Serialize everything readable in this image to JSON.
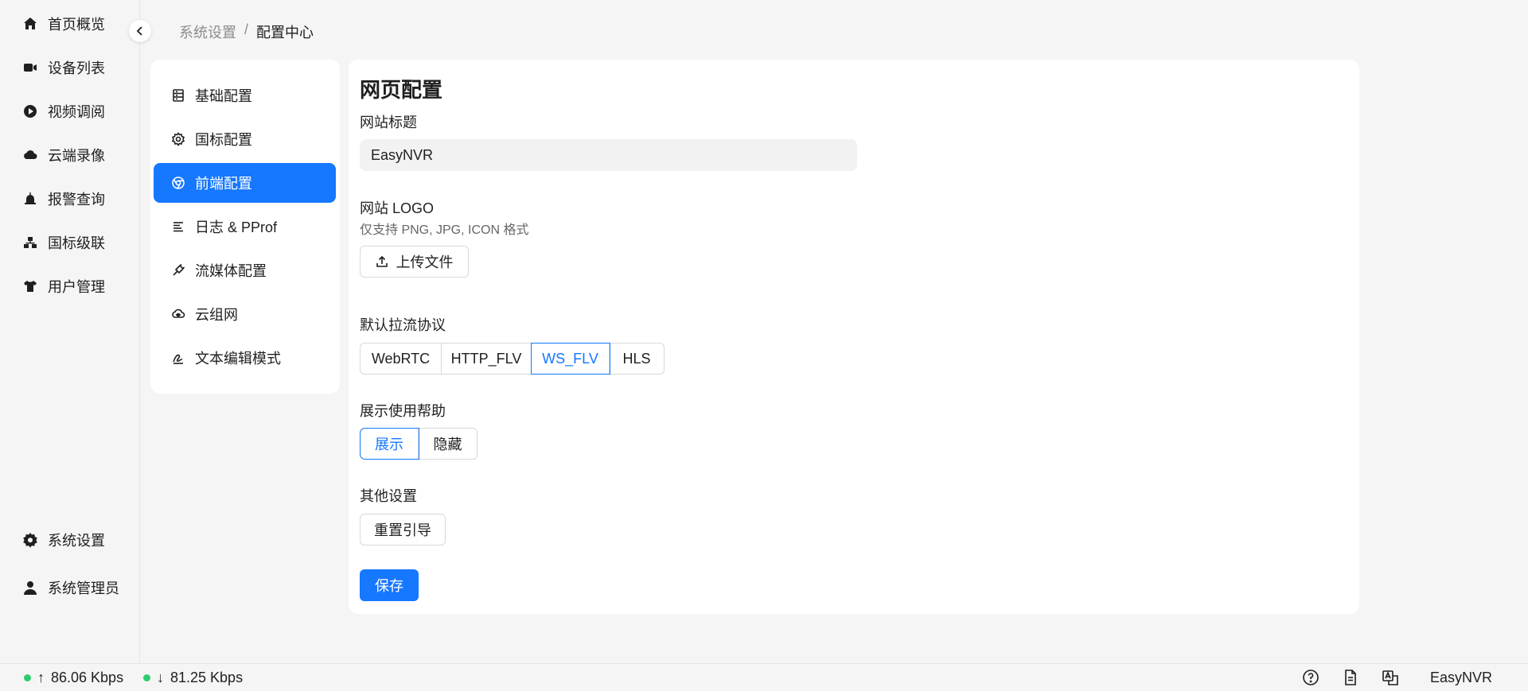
{
  "nav": {
    "items": [
      {
        "label": "首页概览",
        "icon": "home-icon"
      },
      {
        "label": "设备列表",
        "icon": "camera-icon"
      },
      {
        "label": "视频调阅",
        "icon": "play-circle-icon"
      },
      {
        "label": "云端录像",
        "icon": "cloud-icon"
      },
      {
        "label": "报警查询",
        "icon": "alarm-icon"
      },
      {
        "label": "国标级联",
        "icon": "cascade-icon"
      },
      {
        "label": "用户管理",
        "icon": "shirt-icon"
      }
    ],
    "bottom": [
      {
        "label": "系统设置",
        "icon": "gear-icon"
      },
      {
        "label": "系统管理员",
        "icon": "user-icon"
      }
    ]
  },
  "breadcrumb": {
    "parent": "系统设置",
    "separator": "/",
    "current": "配置中心"
  },
  "submenu": {
    "items": [
      {
        "label": "基础配置",
        "icon": "server-icon"
      },
      {
        "label": "国标配置",
        "icon": "gear-icon"
      },
      {
        "label": "前端配置",
        "icon": "chrome-icon",
        "active": true
      },
      {
        "label": "日志 & PProf",
        "icon": "align-left-icon"
      },
      {
        "label": "流媒体配置",
        "icon": "plug-icon"
      },
      {
        "label": "云组网",
        "icon": "cloud-network-icon"
      },
      {
        "label": "文本编辑模式",
        "icon": "signature-icon"
      }
    ]
  },
  "form": {
    "title": "网页配置",
    "site_title_label": "网站标题",
    "site_title_value": "EasyNVR",
    "logo_label": "网站 LOGO",
    "logo_hint": "仅支持 PNG, JPG, ICON 格式",
    "upload_label": "上传文件",
    "protocol_label": "默认拉流协议",
    "protocols": [
      "WebRTC",
      "HTTP_FLV",
      "WS_FLV",
      "HLS"
    ],
    "protocol_selected": "WS_FLV",
    "help_label": "展示使用帮助",
    "help_options": [
      "展示",
      "隐藏"
    ],
    "help_selected": "展示",
    "other_label": "其他设置",
    "reset_guide_label": "重置引导",
    "save_label": "保存"
  },
  "status": {
    "upload_rate": "86.06 Kbps",
    "download_rate": "81.25 Kbps",
    "up_arrow": "↑",
    "down_arrow": "↓",
    "brand": "EasyNVR",
    "indicator_color": "#2ecc71"
  },
  "theme": {
    "accent": "#1677ff"
  }
}
